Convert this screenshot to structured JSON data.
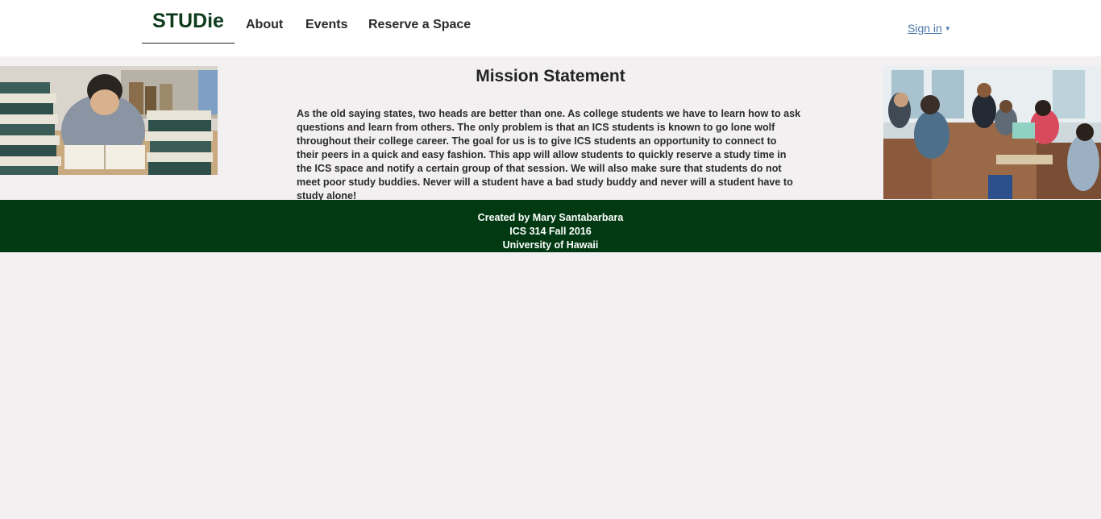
{
  "nav": {
    "brand": "STUDie",
    "items": [
      {
        "label": "About"
      },
      {
        "label": "Events"
      },
      {
        "label": "Reserve a Space"
      }
    ],
    "signin_label": "Sign in",
    "signin_caret": "▼"
  },
  "main": {
    "heading": "Mission Statement",
    "mission_text": "As the old saying states, two heads are better than one. As college students we have to learn how to ask questions and learn from others. The only problem is that an ICS students is known to go lone wolf throughout their college career. The goal for us is to give ICS students an opportunity to connect to their peers in a quick and easy fashion. This app will allow students to quickly reserve a study time in the ICS space and notify a certain group of that session. We will also make sure that students do not meet poor study buddies. Never will a student have a bad study buddy and never will a student have to study alone!",
    "images": {
      "left": "stressed-student-with-books-photo",
      "right": "students-studying-together-photo"
    }
  },
  "footer": {
    "line1": "Created by Mary Santabarbara",
    "line2": "ICS 314 Fall 2016",
    "line3": "University of Hawaii"
  },
  "colors": {
    "brand": "#0e3b1c",
    "footer_bg": "#013a12",
    "link": "#4a78a8",
    "page_bg": "#f2f0f0"
  }
}
